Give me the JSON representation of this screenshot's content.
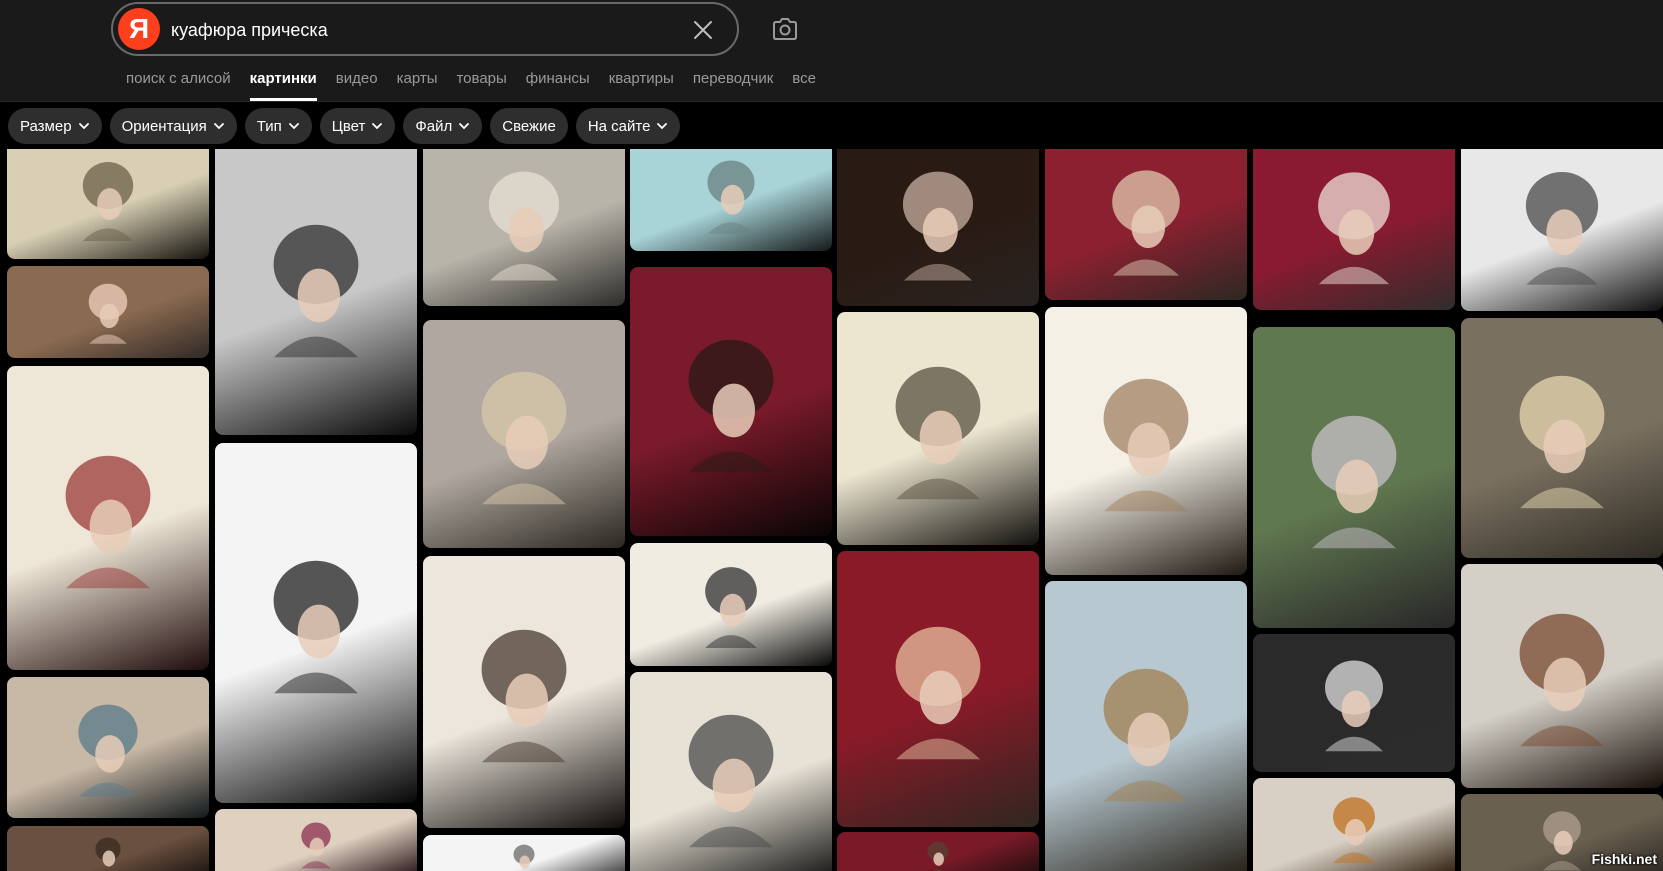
{
  "search": {
    "logo_letter": "Я",
    "query": "куафюра прическа"
  },
  "tabs": [
    {
      "label": "поиск с алисой",
      "active": false
    },
    {
      "label": "картинки",
      "active": true
    },
    {
      "label": "видео",
      "active": false
    },
    {
      "label": "карты",
      "active": false
    },
    {
      "label": "товары",
      "active": false
    },
    {
      "label": "финансы",
      "active": false
    },
    {
      "label": "квартиры",
      "active": false
    },
    {
      "label": "переводчик",
      "active": false
    },
    {
      "label": "все",
      "active": false
    }
  ],
  "filters": [
    {
      "label": "Размер",
      "dropdown": true
    },
    {
      "label": "Ориентация",
      "dropdown": true
    },
    {
      "label": "Тип",
      "dropdown": true
    },
    {
      "label": "Цвет",
      "dropdown": true
    },
    {
      "label": "Файл",
      "dropdown": true
    },
    {
      "label": "Свежие",
      "dropdown": false
    },
    {
      "label": "На сайте",
      "dropdown": true
    }
  ],
  "colors": {
    "header_bg": "#1a1a1a",
    "logo": "#fc3f1d",
    "chip_bg": "#2e2e2e",
    "tab_inactive": "#9a9a9a"
  },
  "watermark": "Fishki.net"
}
